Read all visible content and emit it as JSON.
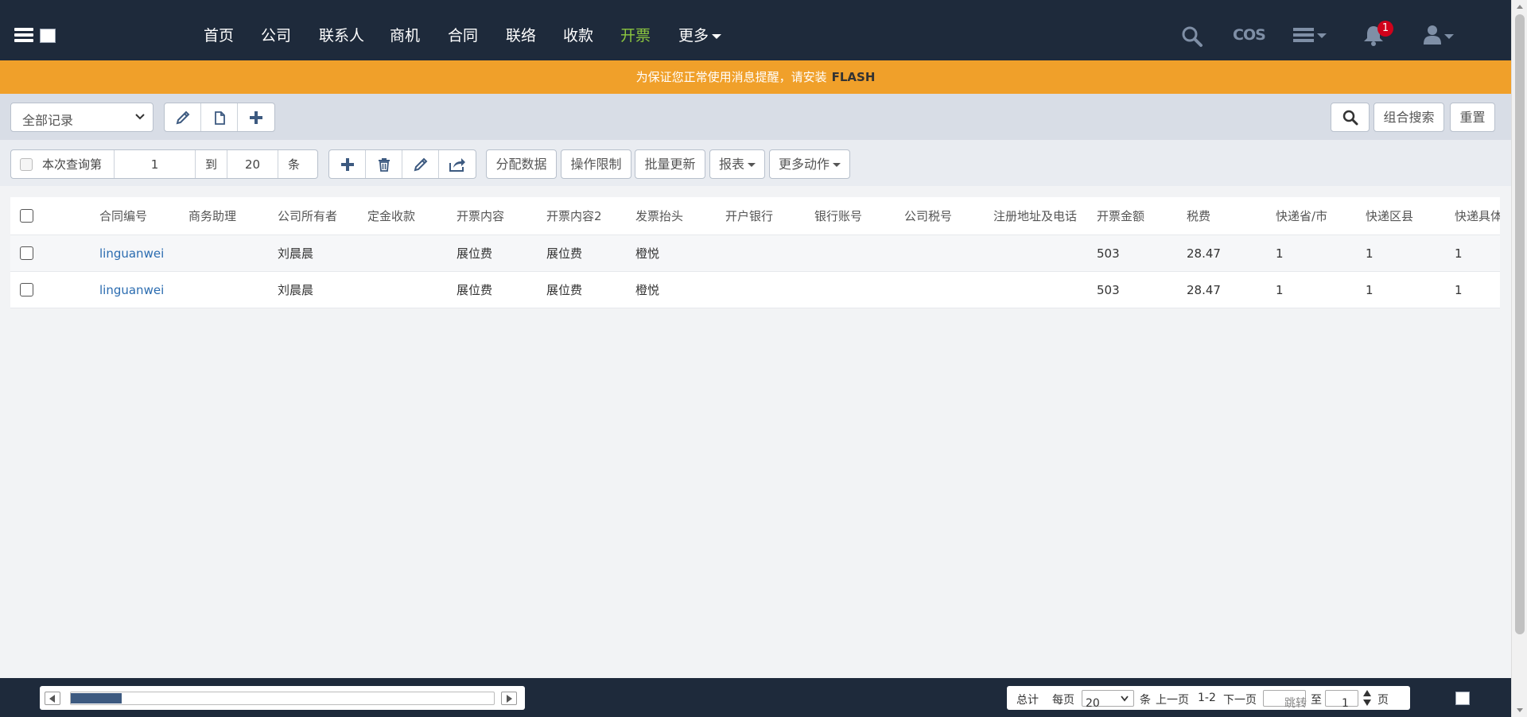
{
  "nav": {
    "items": [
      "首页",
      "公司",
      "联系人",
      "商机",
      "合同",
      "联络",
      "收款",
      "开票",
      "更多"
    ],
    "active_index": 7,
    "cos_label": "COS",
    "notification_count": "1"
  },
  "banner": {
    "text": "为保证您正常使用消息提醒，请安装",
    "highlight": "FLASH"
  },
  "filter": {
    "view_select": "全部记录",
    "search_button": "组合搜索",
    "reset_button": "重置"
  },
  "query": {
    "label": "本次查询第",
    "from": "1",
    "to_label": "到",
    "to": "20",
    "unit": "条"
  },
  "actions": {
    "assign": "分配数据",
    "restrict": "操作限制",
    "batch_update": "批量更新",
    "report": "报表",
    "more": "更多动作"
  },
  "table": {
    "columns": [
      "合同编号",
      "商务助理",
      "公司所有者",
      "定金收款",
      "开票内容",
      "开票内容2",
      "发票抬头",
      "开户银行",
      "银行账号",
      "公司税号",
      "注册地址及电话",
      "开票金额",
      "税费",
      "快递省/市",
      "快递区县",
      "快递具体"
    ],
    "rows": [
      [
        "linguanwei",
        "",
        "刘晨晨",
        "",
        "展位费",
        "展位费",
        "橙悦",
        "",
        "",
        "",
        "",
        "503",
        "28.47",
        "1",
        "1",
        "1"
      ],
      [
        "linguanwei",
        "",
        "刘晨晨",
        "",
        "展位费",
        "展位费",
        "橙悦",
        "",
        "",
        "",
        "",
        "503",
        "28.47",
        "1",
        "1",
        "1"
      ]
    ]
  },
  "pager": {
    "total_label": "总计",
    "per_page_label": "每页",
    "per_page_value": "20",
    "unit": "条",
    "prev": "上一页",
    "range": "1-2",
    "next": "下一页",
    "jump_placeholder": "跳转",
    "to_label": "至",
    "page_value": "1",
    "page_unit": "页"
  },
  "colors": {
    "nav_bg": "#1e2a3b",
    "active_nav": "#8cc63f",
    "banner_bg": "#f0a02a",
    "link": "#2b6cb0",
    "badge": "#d0021b"
  }
}
